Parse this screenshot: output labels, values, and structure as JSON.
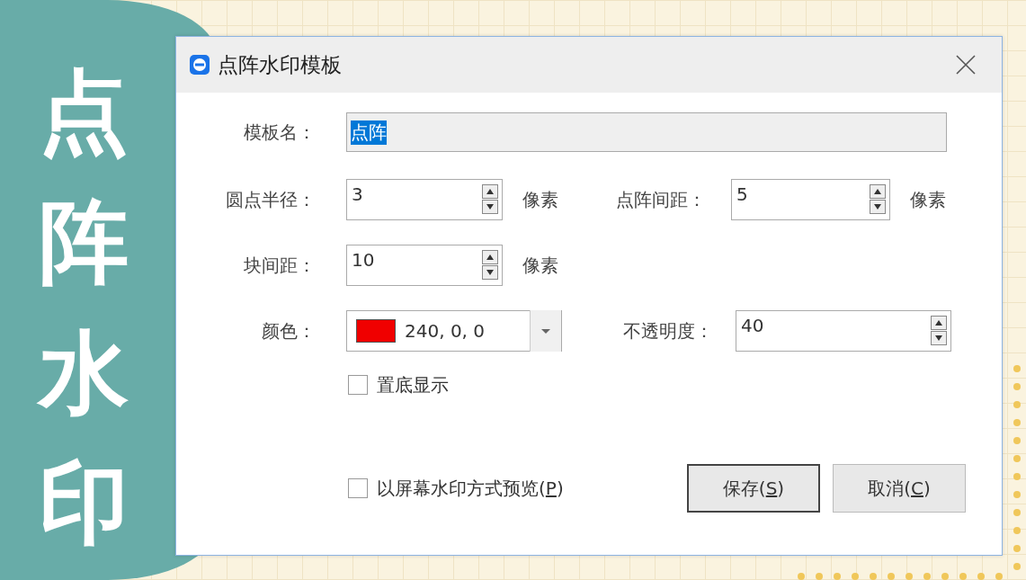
{
  "banner": {
    "title": "点阵水印"
  },
  "dialog": {
    "title": "点阵水印模板",
    "name_row": {
      "label": "模板名：",
      "value": "点阵",
      "text_selected": true
    },
    "rows": [
      {
        "kind": "spin_pair",
        "fields": [
          {
            "label": "圆点半径：",
            "value": "3",
            "unit": "像素"
          },
          {
            "label": "点阵间距：",
            "value": "5",
            "unit": "像素"
          }
        ]
      },
      {
        "kind": "spin_single",
        "fields": [
          {
            "label": "块间距：",
            "value": "10",
            "unit": "像素"
          }
        ]
      },
      {
        "kind": "color",
        "fields": [
          {
            "label": "颜色：",
            "value": "240, 0, 0",
            "color": "#f00000"
          },
          {
            "label": "不透明度：",
            "value": "40"
          }
        ]
      }
    ],
    "bottom_checkbox": {
      "label": "置底显示",
      "checked": false
    },
    "preview_checkbox": {
      "label": "以屏幕水印方式预览(",
      "mnemonic": "P",
      "label_end": ")",
      "checked": false
    },
    "buttons": [
      {
        "label": "保存(",
        "mnemonic": "S",
        "label_end": ")",
        "default": true
      },
      {
        "label": "取消(",
        "mnemonic": "C",
        "label_end": ")",
        "default": false
      }
    ]
  }
}
